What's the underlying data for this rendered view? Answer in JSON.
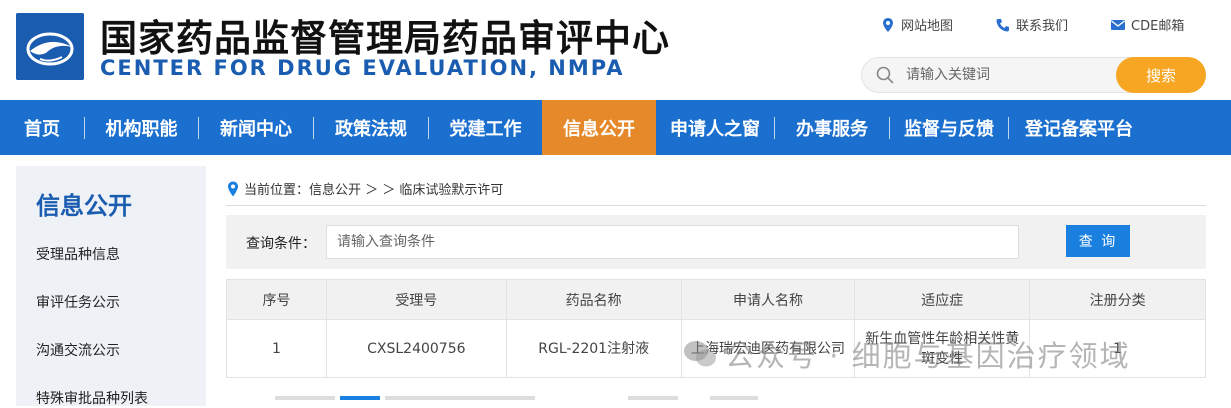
{
  "header": {
    "title_cn": "国家药品监督管理局药品审评中心",
    "title_en": "CENTER FOR DRUG EVALUATION, NMPA",
    "links": [
      {
        "label": "网站地图",
        "icon": "map-pin-icon"
      },
      {
        "label": "联系我们",
        "icon": "phone-icon"
      },
      {
        "label": "CDE邮箱",
        "icon": "mail-icon"
      }
    ],
    "search_placeholder": "请输入关键词",
    "search_button": "搜索"
  },
  "nav": {
    "items": [
      "首页",
      "机构职能",
      "新闻中心",
      "政策法规",
      "党建工作",
      "信息公开",
      "申请人之窗",
      "办事服务",
      "监督与反馈",
      "登记备案平台"
    ],
    "active": "信息公开"
  },
  "sidebar": {
    "title": "信息公开",
    "items": [
      "受理品种信息",
      "审评任务公示",
      "沟通交流公示",
      "特殊审批品种列表"
    ]
  },
  "breadcrumb": {
    "prefix": "当前位置：信息公开 ＞ ＞ 临床试验默示许可"
  },
  "query": {
    "label": "查询条件：",
    "placeholder": "请输入查询条件",
    "button": "查 询"
  },
  "table": {
    "columns": [
      "序号",
      "受理号",
      "药品名称",
      "申请人名称",
      "适应症",
      "注册分类"
    ],
    "rows": [
      [
        "1",
        "CXSL2400756",
        "RGL-2201注射液",
        "上海瑞宏迪医药有限公司",
        "新生血管性年龄相关性黄斑变性",
        "1"
      ]
    ]
  },
  "watermark": "公众号 · 细胞与基因治疗领域",
  "colors": {
    "brand_blue": "#1a6fcf",
    "accent_orange": "#e6892b",
    "search_orange": "#f6a623",
    "query_blue": "#1a80e0"
  }
}
